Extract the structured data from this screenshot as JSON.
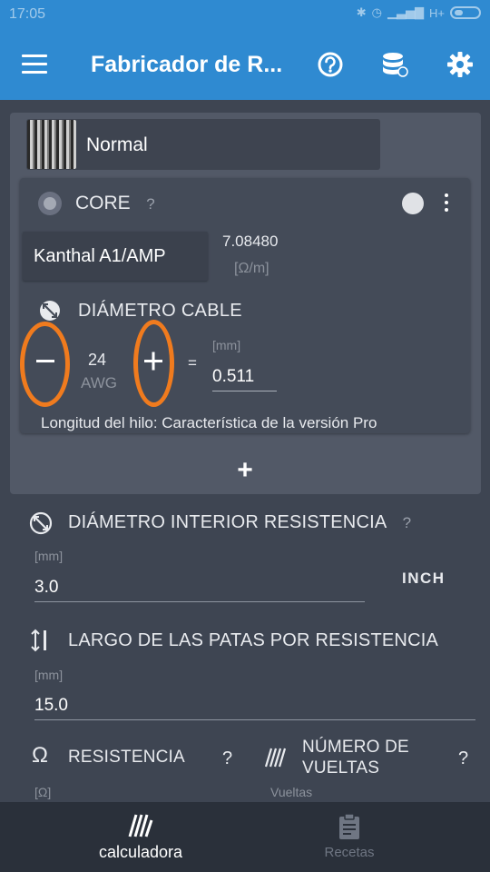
{
  "status_bar": {
    "time": "17:05",
    "network": "H+"
  },
  "app_bar": {
    "title": "Fabricador de R...",
    "icons": [
      "menu-icon",
      "help-icon",
      "database-icon",
      "settings-icon"
    ]
  },
  "coil": {
    "type_label": "Normal",
    "core": {
      "label": "CORE",
      "help": "?",
      "material": "Kanthal A1/AMP",
      "resistivity_value": "7.08480",
      "resistivity_unit": "[Ω/m]",
      "diameter": {
        "label": "DIÁMETRO CABLE",
        "awg_value": "24",
        "awg_unit": "AWG",
        "equals": "=",
        "mm_unit": "[mm]",
        "mm_value": "0.511"
      },
      "pro_note": "Longitud del hilo: Característica de la versión Pro"
    },
    "add_label": "+"
  },
  "inner_diameter": {
    "label": "DIÁMETRO INTERIOR RESISTENCIA",
    "help": "?",
    "unit": "[mm]",
    "value": "3.0",
    "toggle_label": "INCH"
  },
  "leg_length": {
    "label": "LARGO DE LAS PATAS POR RESISTENCIA",
    "unit": "[mm]",
    "value": "15.0"
  },
  "resistance": {
    "label": "RESISTENCIA",
    "help": "?",
    "unit": "[Ω]"
  },
  "wraps": {
    "label_line1": "NÚMERO DE",
    "label_line2": "VUELTAS",
    "help": "?",
    "unit": "Vueltas"
  },
  "bottom_nav": {
    "items": [
      {
        "label": "calculadora",
        "icon": "coil-icon",
        "active": true
      },
      {
        "label": "Recetas",
        "icon": "clipboard-icon",
        "active": false
      }
    ]
  },
  "colors": {
    "app_bar": "#2f8ad1",
    "background": "#3e4552",
    "card": "#525967",
    "highlight_ring": "#f07b1e"
  }
}
